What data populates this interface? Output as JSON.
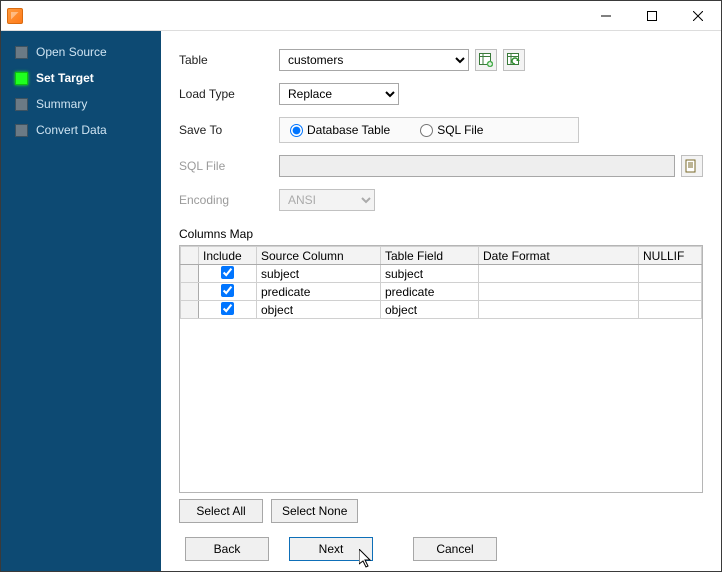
{
  "window": {
    "title": ""
  },
  "sidebar": {
    "steps": [
      {
        "label": "Open Source",
        "active": false
      },
      {
        "label": "Set Target",
        "active": true
      },
      {
        "label": "Summary",
        "active": false
      },
      {
        "label": "Convert Data",
        "active": false
      }
    ]
  },
  "form": {
    "table_label": "Table",
    "table_value": "customers",
    "loadtype_label": "Load Type",
    "loadtype_value": "Replace",
    "saveto_label": "Save To",
    "saveto_options": {
      "db": "Database Table",
      "sql": "SQL File"
    },
    "saveto_selected": "db",
    "sqlfile_label": "SQL File",
    "sqlfile_value": "",
    "encoding_label": "Encoding",
    "encoding_value": "ANSI"
  },
  "columns_map": {
    "title": "Columns Map",
    "headers": {
      "include": "Include",
      "source": "Source Column",
      "target": "Table Field",
      "date": "Date Format",
      "nullif": "NULLIF"
    },
    "rows": [
      {
        "include": true,
        "source": "subject",
        "target": "subject",
        "date": "",
        "nullif": ""
      },
      {
        "include": true,
        "source": "predicate",
        "target": "predicate",
        "date": "",
        "nullif": ""
      },
      {
        "include": true,
        "source": "object",
        "target": "object",
        "date": "",
        "nullif": ""
      }
    ],
    "buttons": {
      "select_all": "Select All",
      "select_none": "Select None"
    }
  },
  "footer": {
    "back": "Back",
    "next": "Next",
    "cancel": "Cancel"
  },
  "icons": {
    "add_table": "table-add-icon",
    "refresh_table": "table-refresh-icon",
    "browse": "browse-file-icon"
  }
}
